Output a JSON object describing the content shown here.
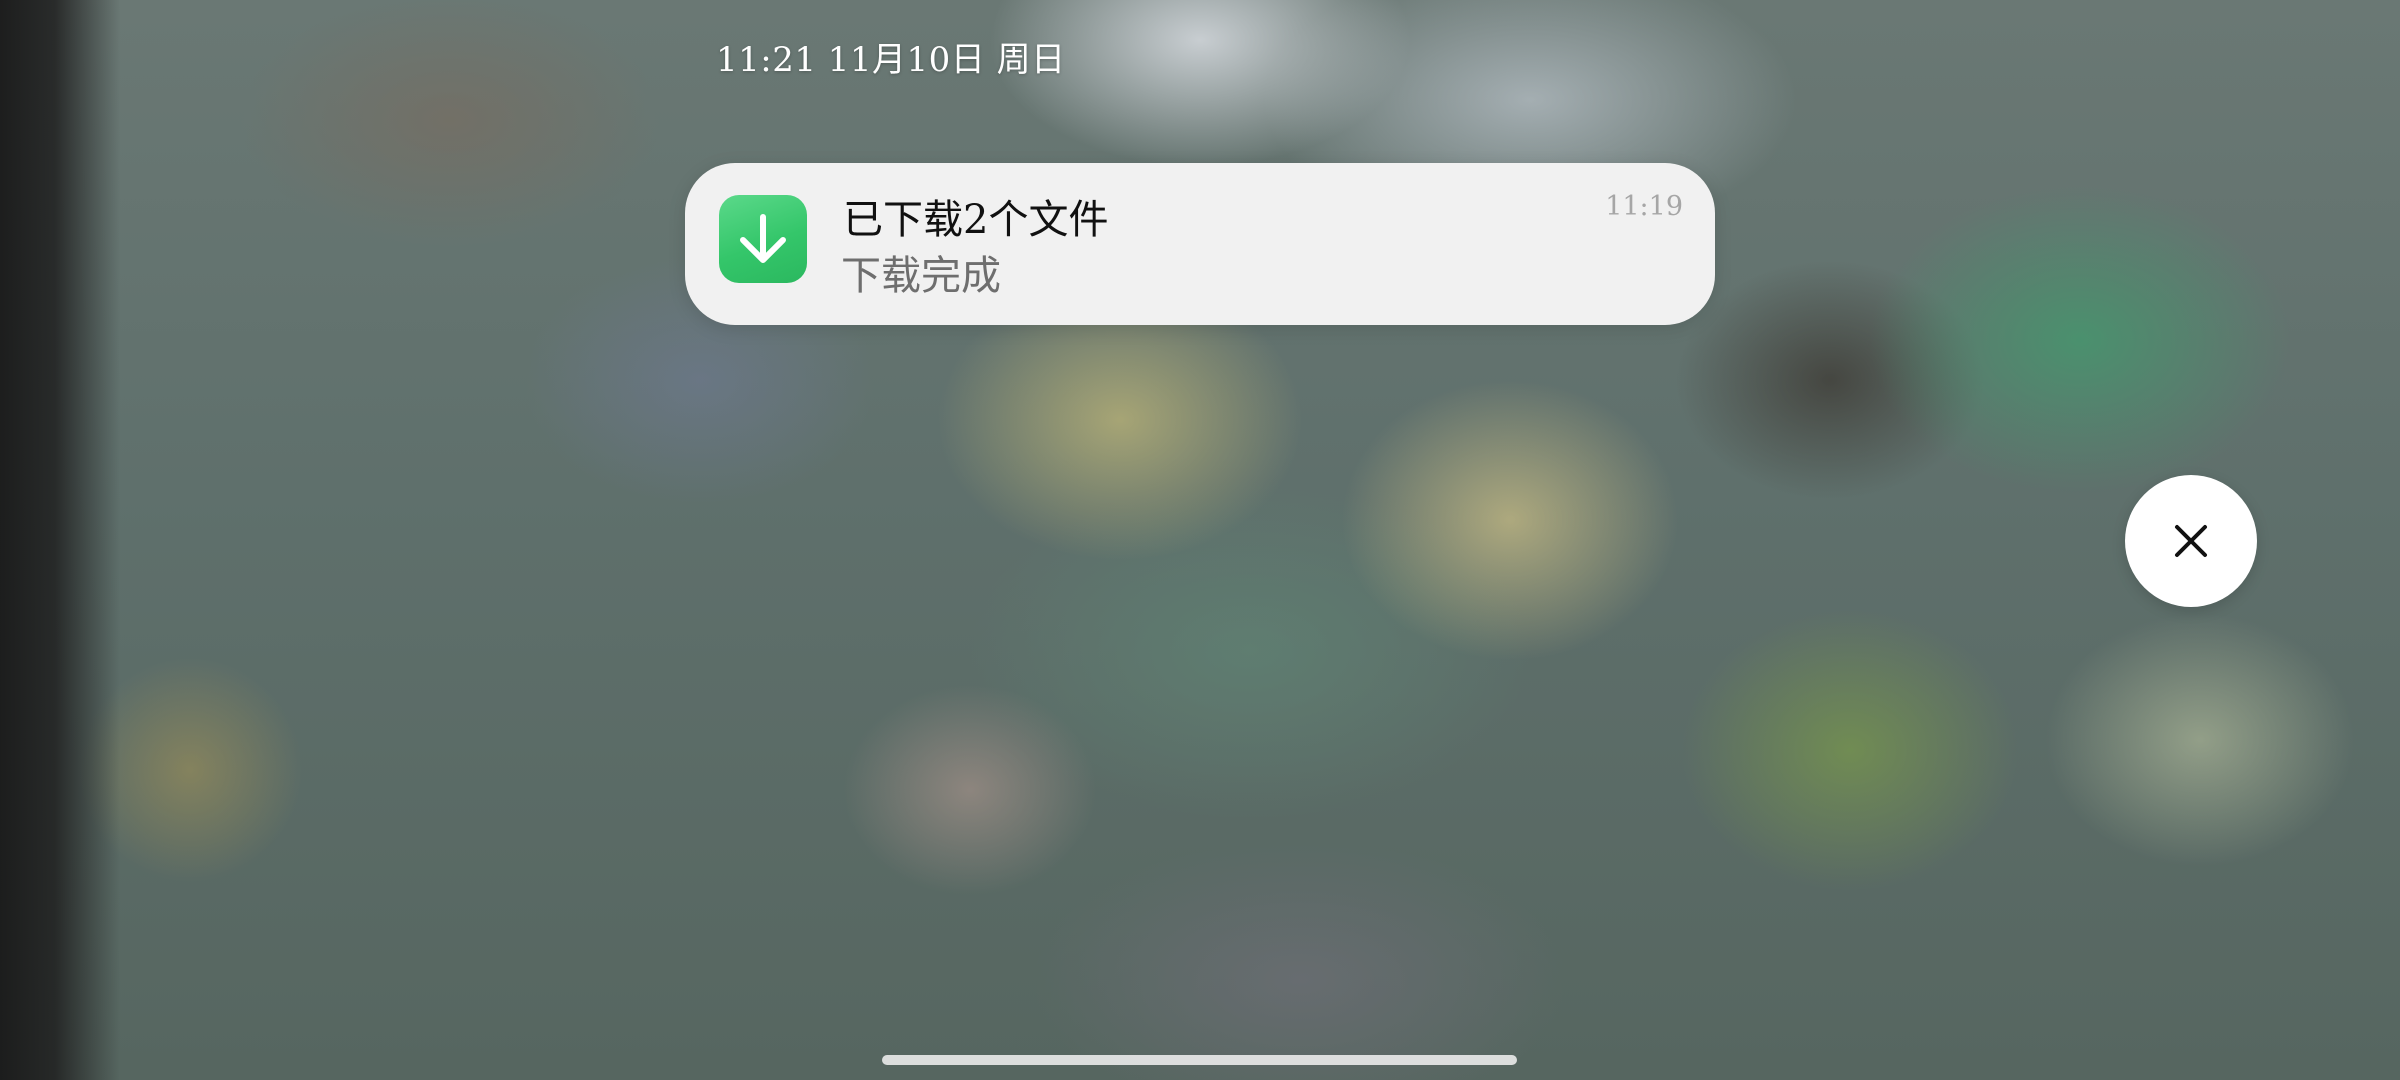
{
  "status_bar": {
    "time_date": "11:21  11月10日  周日"
  },
  "notification": {
    "app_icon": "download-arrow-icon",
    "title": "已下载2个文件",
    "body": "下载完成",
    "time": "11:19",
    "icon_color": "#34c66a"
  },
  "controls": {
    "close_icon": "close-icon"
  }
}
